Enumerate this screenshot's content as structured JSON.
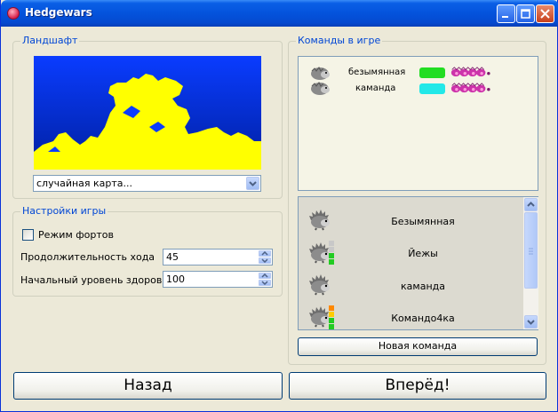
{
  "window": {
    "title": "Hedgewars"
  },
  "landscape": {
    "title": "Ландшафт",
    "map_select_value": "случайная карта..."
  },
  "settings": {
    "title": "Настройки игры",
    "forts_mode_label": "Режим фортов",
    "forts_mode_checked": false,
    "turn_time_label": "Продолжительность хода",
    "turn_time_value": "45",
    "initial_health_label": "Начальный уровень здоровья",
    "initial_health_value": "100"
  },
  "teams_in_game": {
    "title": "Команды в игре",
    "teams": [
      {
        "name": "безымянная",
        "color": "#22dd22"
      },
      {
        "name": "каманда",
        "color": "#22e8e8"
      }
    ]
  },
  "available_teams": [
    {
      "name": "Безымянная",
      "level_colors": []
    },
    {
      "name": "Йежы",
      "level_colors": [
        "#c8c8c8",
        "#c8c8c8",
        "#22cc22",
        "#22cc22"
      ]
    },
    {
      "name": "каманда",
      "level_colors": []
    },
    {
      "name": "Командо4ка",
      "level_colors": [
        "#ff8800",
        "#ffcc00",
        "#22cc22",
        "#22cc22"
      ]
    }
  ],
  "buttons": {
    "new_team": "Новая команда",
    "back": "Назад",
    "forward": "Вперёд!"
  },
  "colors": {
    "accent_title": "#0046d5",
    "map_water": "#0a3cff",
    "map_land": "#ffff00"
  }
}
